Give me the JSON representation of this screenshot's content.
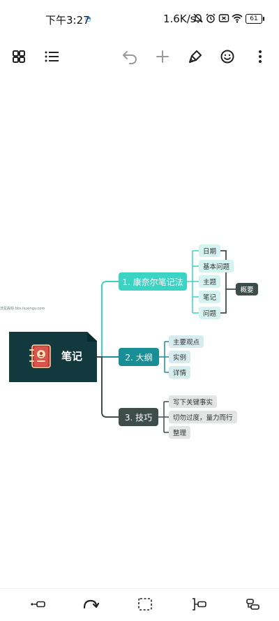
{
  "status_bar": {
    "time": "下午3:27",
    "signal_tag": "◔",
    "net_speed": "1.6K/s",
    "battery": "61"
  },
  "toolbar": {
    "left": [
      "grid-icon",
      "outline-list-icon"
    ],
    "right": [
      "undo-icon",
      "add-icon",
      "format-brush-icon",
      "emoji-icon",
      "more-icon"
    ]
  },
  "mindmap": {
    "root": {
      "label": "笔记",
      "icon": "notebook-icon"
    },
    "branches": [
      {
        "label": "1. 康奈尔笔记法",
        "color": "#3bd4c4",
        "leaves": [
          "日期",
          "基本问题",
          "主题",
          "笔记",
          "问题"
        ],
        "summary": "概要"
      },
      {
        "label": "2. 大纲",
        "color": "#1a8e95",
        "leaves": [
          "主要观点",
          "实例",
          "详情"
        ]
      },
      {
        "label": "3. 技巧",
        "color": "#3d4d4a",
        "leaves": [
          "写下关键事实",
          "切勿过度，量力而行",
          "整理"
        ]
      }
    ],
    "watermark": "流星般柏 bbs.liuxingu.com"
  },
  "bottom_bar": [
    "add-child-icon",
    "redo-icon",
    "select-icon",
    "add-summary-icon",
    "add-sibling-icon"
  ]
}
